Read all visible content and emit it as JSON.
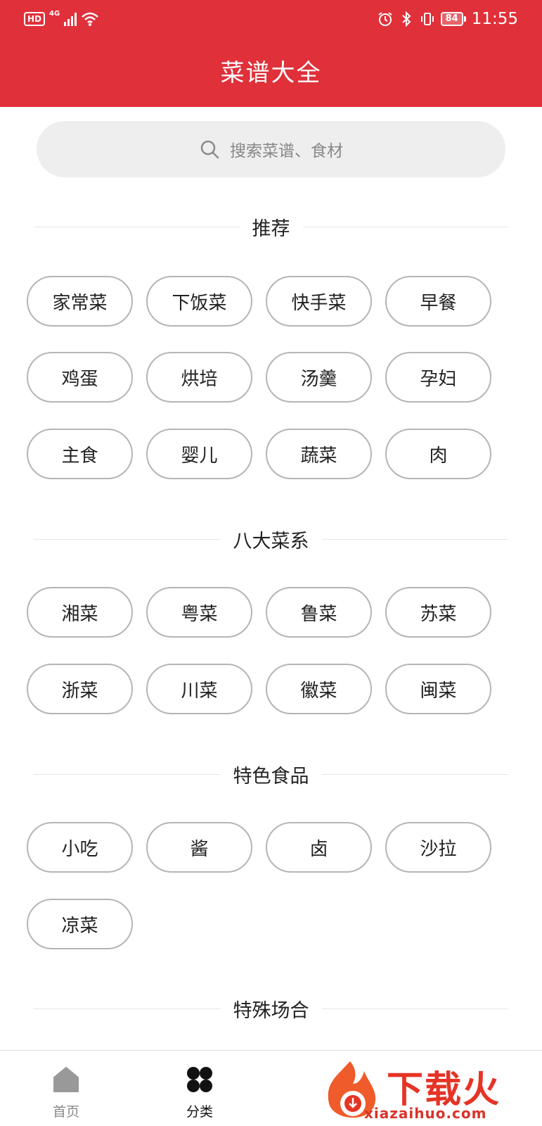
{
  "status_bar": {
    "hd": "HD",
    "network": "4G",
    "battery": "84",
    "time": "11:55"
  },
  "header": {
    "title": "菜谱大全"
  },
  "search": {
    "placeholder": "搜索菜谱、食材",
    "icon": "search-icon"
  },
  "sections": [
    {
      "title": "推荐",
      "items": [
        "家常菜",
        "下饭菜",
        "快手菜",
        "早餐",
        "鸡蛋",
        "烘培",
        "汤羹",
        "孕妇",
        "主食",
        "婴儿",
        "蔬菜",
        "肉"
      ]
    },
    {
      "title": "八大菜系",
      "items": [
        "湘菜",
        "粤菜",
        "鲁菜",
        "苏菜",
        "浙菜",
        "川菜",
        "徽菜",
        "闽菜"
      ]
    },
    {
      "title": "特色食品",
      "items": [
        "小吃",
        "酱",
        "卤",
        "沙拉",
        "凉菜"
      ]
    },
    {
      "title": "特殊场合",
      "items": []
    }
  ],
  "bottom_nav": [
    {
      "label": "首页",
      "icon": "home-icon",
      "active": false
    },
    {
      "label": "分类",
      "icon": "category-icon",
      "active": true
    }
  ],
  "watermark": {
    "text": "下载火",
    "url": "xiazaihuo.com"
  },
  "colors": {
    "header": "#e0303a",
    "chip_border": "#b5b5b5",
    "search_bg": "#eeeeee"
  }
}
